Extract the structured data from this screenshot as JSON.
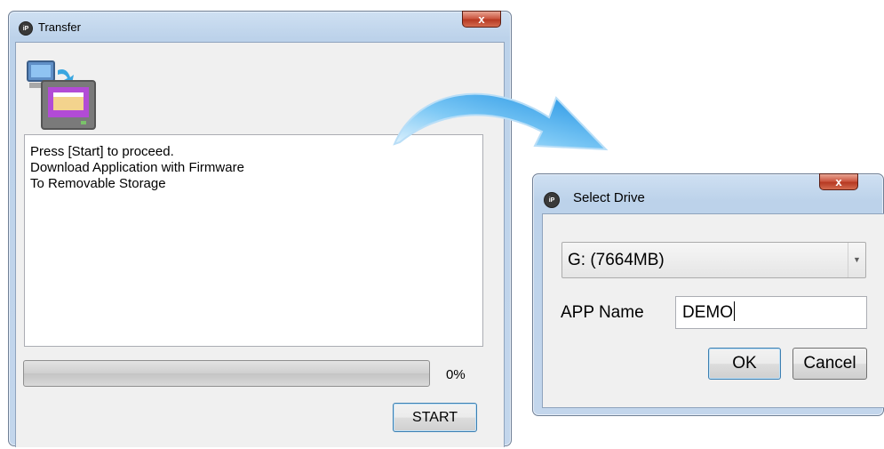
{
  "transfer_window": {
    "title": "Transfer",
    "icon": "app-logo-icon",
    "close_label": "x",
    "log_lines": [
      "Press [Start] to proceed.",
      "Download Application with Firmware",
      "To Removable Storage"
    ],
    "progress_value": 0,
    "progress_percent_label": "0%",
    "start_label": "START"
  },
  "select_drive_window": {
    "title": "Select Drive",
    "icon": "app-logo-icon",
    "close_label": "x",
    "drive_selected": "G: (7664MB)",
    "app_name_label": "APP Name",
    "app_name_value": "DEMO",
    "ok_label": "OK",
    "cancel_label": "Cancel"
  },
  "colors": {
    "arrow_blue": "#3aa0e8",
    "progress_green": "#06b025",
    "close_red": "#c9513a"
  }
}
